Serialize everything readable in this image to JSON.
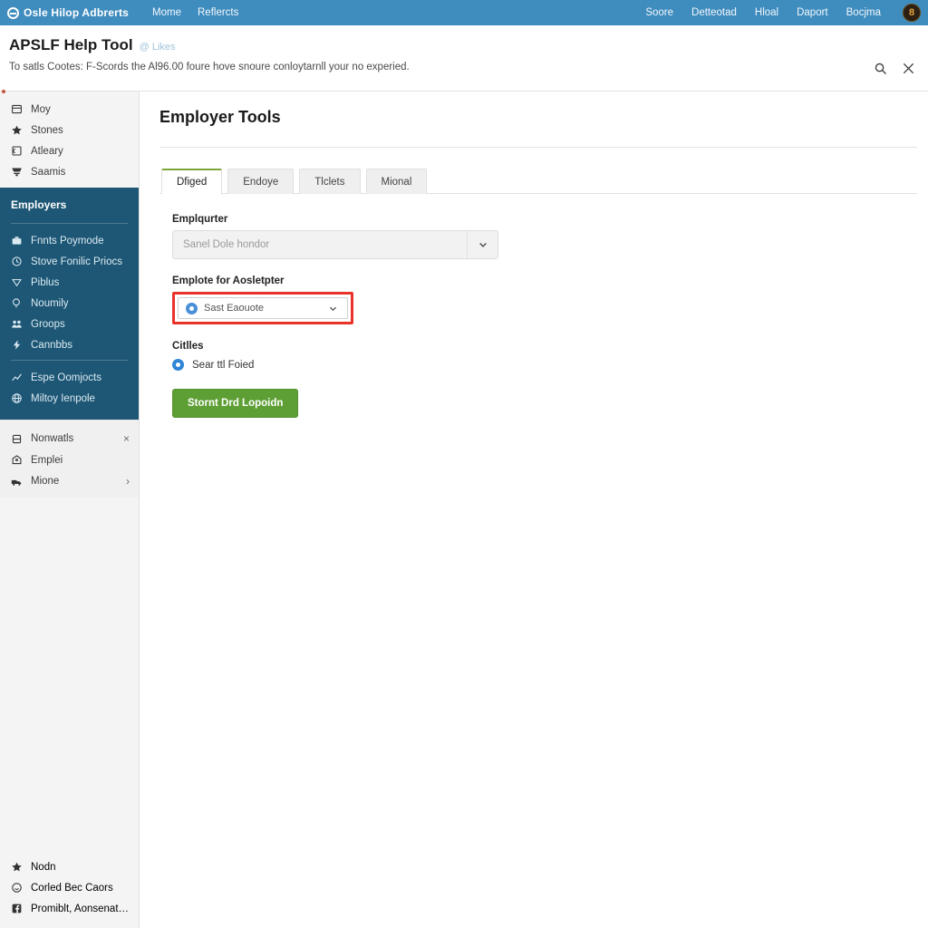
{
  "topbar": {
    "brand": "Osle Hilop Adbrerts",
    "logo_icon": "circle-logo-icon",
    "nav": [
      {
        "label": "Mome"
      },
      {
        "label": "Reflercts"
      }
    ],
    "nav_right": [
      {
        "label": "Soore"
      },
      {
        "label": "Detteotad"
      },
      {
        "label": "Hloal"
      },
      {
        "label": "Daport"
      },
      {
        "label": "Bocjma"
      }
    ],
    "avatar_initial": "8"
  },
  "pagehead": {
    "title": "APSLF Help Tool",
    "subtag": "@ Likes",
    "description": "To satls Cootes: F-Scords the Al96.00 foure hove snoure conloytarnll your no experied.",
    "search_icon": "search-icon",
    "close_icon": "close-icon"
  },
  "sidebar": {
    "top_items": [
      {
        "label": "Moy",
        "icon": "list-icon"
      },
      {
        "label": "Stones",
        "icon": "star-icon"
      },
      {
        "label": "Atleary",
        "icon": "book-icon"
      },
      {
        "label": "Saamis",
        "icon": "cart-icon"
      }
    ],
    "section_title": "Employers",
    "dark_items": [
      {
        "label": "Fnnts Poymode",
        "icon": "briefcase-icon"
      },
      {
        "label": "Stove Fonilic Priocs",
        "icon": "clock-icon"
      },
      {
        "label": "Piblus",
        "icon": "tag-icon"
      },
      {
        "label": "Noumily",
        "icon": "search-circle-icon"
      },
      {
        "label": "Groops",
        "icon": "people-icon"
      },
      {
        "label": "Cannbbs",
        "icon": "bolt-icon"
      }
    ],
    "dark_items_second": [
      {
        "label": "Espe Oomjocts",
        "icon": "chart-up-icon"
      },
      {
        "label": "Miltoy Ienpole",
        "icon": "globe-icon"
      }
    ],
    "mid_items": [
      {
        "label": "Nonwatls",
        "icon": "lock-icon",
        "trailing": "×",
        "trailing_icon": "close-icon"
      },
      {
        "label": "Emplei",
        "icon": "home-icon",
        "trailing": "",
        "trailing_icon": ""
      },
      {
        "label": "Mione",
        "icon": "truck-icon",
        "trailing": "›",
        "trailing_icon": "chevron-right-icon"
      }
    ],
    "footer_items": [
      {
        "label": "Nodn",
        "icon": "star-icon"
      },
      {
        "label": "Corled Bec Caors",
        "icon": "smile-icon"
      },
      {
        "label": "Promiblt, Aonsenated",
        "icon": "facebook-icon"
      }
    ]
  },
  "main": {
    "title": "Employer Tools",
    "tabs": [
      {
        "label": "Dfiged",
        "active": true
      },
      {
        "label": "Endoye",
        "active": false
      },
      {
        "label": "Tlclets",
        "active": false
      },
      {
        "label": "Mional",
        "active": false
      }
    ],
    "form": {
      "employer_label": "Emplqurter",
      "employer_placeholder": "Sanel Dole hondor",
      "assign_label": "Emplote for Aosletpter",
      "assign_value": "Sast Eaouote",
      "cities_label": "Citlles",
      "radio_label": "Sear ttl Foied",
      "submit_label": "Stornt Drd Lopoidn"
    }
  },
  "colors": {
    "topbar": "#3f8cbe",
    "sidebar_dark": "#1d5775",
    "accent_green": "#5e9f35",
    "tab_active_border": "#7ea53b",
    "highlight_red": "#e8322a",
    "radio_blue": "#2f86d6"
  }
}
